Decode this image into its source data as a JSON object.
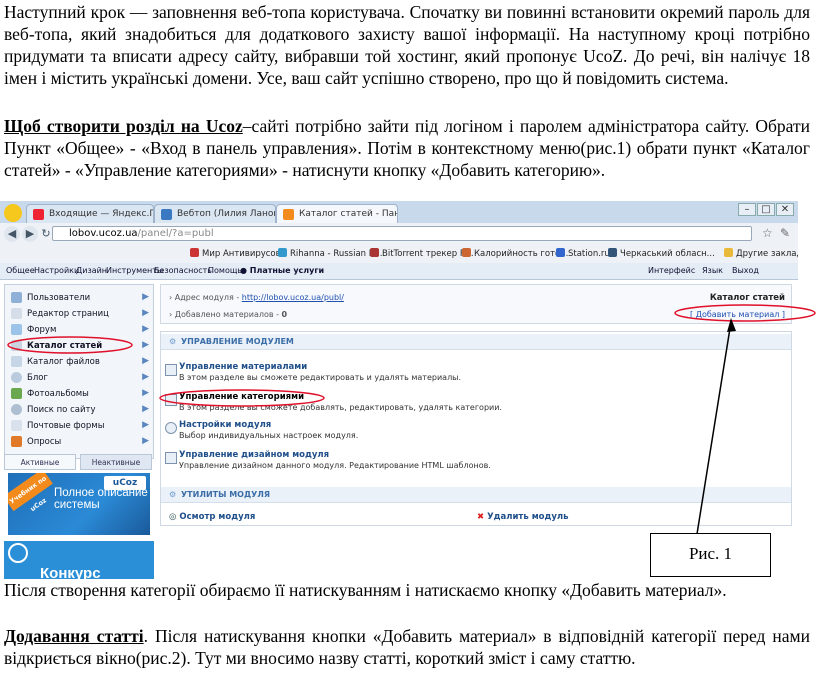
{
  "para1": "Наступний крок — заповнення веб-топа користувача. Спочатку ви повинні встановити окремий пароль для веб-топа, який знадобиться для додаткового захисту вашої інформації. На наступному кроці потрібно придумати та вписати адресу сайту, вибравши той хостинг, який пропонує UcoZ. До речі, він налічує 18 імен і містить українські домени. Усе, ваш сайт успішно створено, про що й повідомить система.",
  "para2": {
    "lead": "Щоб створити розділ на Ucoz",
    "rest": "–сайті потрібно зайти під логіном і паролем адміністратора сайту.  Обрати Пункт «Общее» - «Вход в панель управления». Потім в контекстному меню(рис.1) обрати пункт «Каталог статей» - «Управление категориями» - натиснути кнопку «Добавить категорию»."
  },
  "para3": "Після створення категорії обираємо її натискуванням і натискаємо кнопку «Добавить материал».",
  "para4": {
    "lead": "Додавання статті",
    "rest": ". Після натискування кнопки  «Добавить материал» в відповідній категорії перед нами відкриється вікно(рис.2). Тут ми вносимо назву статті, короткий зміст і саму статтю."
  },
  "figure_caption": "Рис. 1",
  "browser": {
    "tabs": [
      "Входящие — Яндекс.Почта",
      "Вебтоп (Лилия Лановская)",
      "Каталог статей - Панель у"
    ],
    "url_host": "lobov.ucoz.ua",
    "url_path": "/panel/?a=publ",
    "bookmarks": [
      "Мир Антивирусов",
      "Rihanna - Russian R...",
      "BitTorrent трекер R...",
      "Калорийность гото...",
      "Station.ru",
      "Черкаський обласн...",
      "Другие закладки"
    ],
    "menu": [
      "Общее",
      "Настройки",
      "Дизайн",
      "Инструменты",
      "Безопасность",
      "Помощь",
      "Платные услуги"
    ],
    "menu_right": [
      "Интерфейс",
      "Язык",
      "Выход"
    ]
  },
  "sidebar": {
    "items": [
      "Пользователи",
      "Редактор страниц",
      "Форум",
      "Каталог статей",
      "Каталог файлов",
      "Блог",
      "Фотоальбомы",
      "Поиск по сайту",
      "Почтовые формы",
      "Опросы"
    ],
    "tab_active": "Активные",
    "tab_inactive": "Неактивные"
  },
  "ads": {
    "ad1_badge": "Учебник по uCoz",
    "ad1_text": "Полное описание системы",
    "ad1_logo": "uCoz",
    "ad2_text": "Конкурс"
  },
  "main": {
    "addr_label": "Адрес модуля - ",
    "addr_link": "http://lobov.ucoz.ua/publ/",
    "added_label": "Добавлено материалов - ",
    "added_count": "0",
    "title": "Каталог статей",
    "add_button": "[ Добавить материал ]",
    "section_manage": "УПРАВЛЕНИЕ МОДУЛЕМ",
    "modules": [
      {
        "title": "Управление материалами",
        "desc": "В этом разделе вы сможете редактировать и удалять материалы."
      },
      {
        "title": "Управление категориями",
        "desc": "В этом разделе вы сможете добавлять, редактировать, удалять категории."
      },
      {
        "title": "Настройки модуля",
        "desc": "Выбор индивидуальных настроек модуля."
      },
      {
        "title": "Управление дизайном модуля",
        "desc": "Управление дизайном данного модуля. Редактирование HTML шаблонов."
      }
    ],
    "section_utils": "УТИЛИТЫ МОДУЛЯ",
    "util_view": "Осмотр модуля",
    "util_delete": "Удалить модуль"
  }
}
